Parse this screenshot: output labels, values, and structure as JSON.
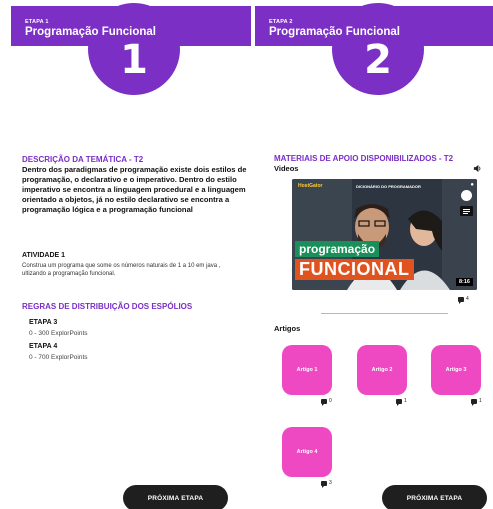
{
  "stage1": {
    "small_label": "ETAPA 1",
    "title": "Programação Funcional",
    "number": "1",
    "description_title": "DESCRIÇÃO DA TEMÁTICA - T2",
    "description_body": "Dentro dos paradigmas de programação existe dois estilos de programação, o declarativo e o imperativo. Dentro do estilo imperativo se encontra a linguagem procedural e a linguagem orientado a objetos, já no estilo declarativo se encontra a programação lógica e a programação funcional",
    "activity_label": "ATIVIDADE 1",
    "activity_body": "Construa um programa que some os números naturais de 1 a 10 em java , ultizando a programação funcional.",
    "rules_title": "REGRAS DE DISTRIBUIÇÃO DOS ESPÓLIOS",
    "rules": [
      {
        "stage": "ETAPA 3",
        "points": "0 - 300 ExplorPoints"
      },
      {
        "stage": "ETAPA 4",
        "points": "0 - 700 ExplorPoints"
      }
    ],
    "next_button": "PRÓXIMA ETAPA"
  },
  "stage2": {
    "small_label": "ETAPA 2",
    "title": "Programação Funcional",
    "number": "2",
    "materials_title": "MATERIAIS DE APOIO DISPONIBILIZADOS - T2",
    "videos_label": "Videos",
    "video": {
      "brand": "HostGator",
      "channel": "DICIONÁRIO DO PROGRAMADOR",
      "word1": "programação",
      "word2": "FUNCIONAL",
      "duration": "8:16",
      "comments": "4"
    },
    "articles_label": "Artigos",
    "articles": [
      {
        "label": "Artigo 1",
        "comments": "0"
      },
      {
        "label": "Artigo 2",
        "comments": "1"
      },
      {
        "label": "Artigo 3",
        "comments": "1"
      },
      {
        "label": "Artigo 4",
        "comments": "3"
      }
    ],
    "next_button": "PRÓXIMA ETAPA"
  },
  "colors": {
    "purple": "#7b2fc4",
    "pink": "#ee48c2",
    "button_dark": "#1f1f1f"
  }
}
